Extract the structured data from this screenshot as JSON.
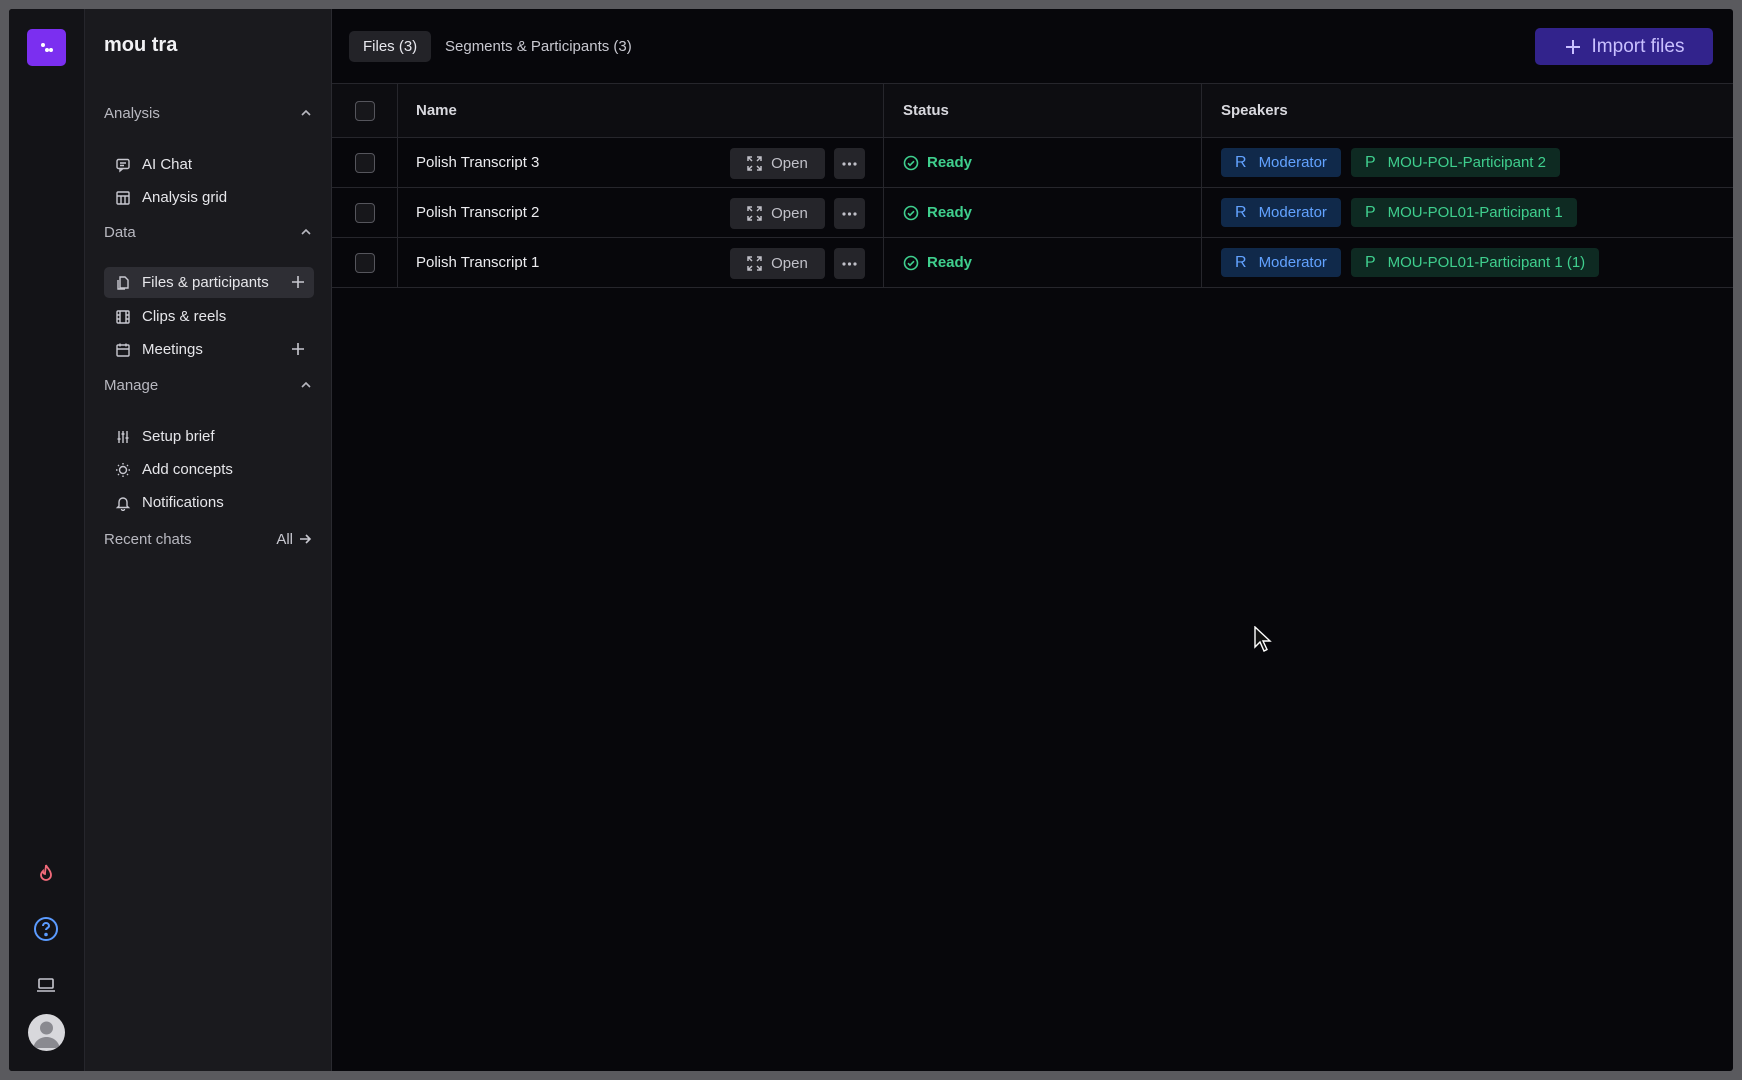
{
  "project": {
    "title": "mou tra"
  },
  "rail": {
    "icons": [
      "logo-icon",
      "flame-icon",
      "help-icon",
      "laptop-icon",
      "avatar"
    ]
  },
  "sidebar": {
    "analysis": {
      "label": "Analysis",
      "items": [
        {
          "label": "AI Chat",
          "icon": "chat-icon"
        },
        {
          "label": "Analysis grid",
          "icon": "grid-icon"
        }
      ]
    },
    "data": {
      "label": "Data",
      "items": [
        {
          "label": "Files & participants",
          "icon": "files-icon",
          "active": true
        },
        {
          "label": "Clips & reels",
          "icon": "film-icon"
        },
        {
          "label": "Meetings",
          "icon": "calendar-icon"
        }
      ]
    },
    "manage": {
      "label": "Manage",
      "items": [
        {
          "label": "Setup brief",
          "icon": "sliders-icon"
        },
        {
          "label": "Add concepts",
          "icon": "bulb-icon"
        },
        {
          "label": "Notifications",
          "icon": "bell-icon"
        }
      ]
    },
    "recent": {
      "label": "Recent chats",
      "all_label": "All"
    }
  },
  "tabs": [
    {
      "label": "Files (3)",
      "active": true
    },
    {
      "label": "Segments & Participants (3)",
      "active": false
    }
  ],
  "import_label": "Import files",
  "table": {
    "columns": [
      "Name",
      "Status",
      "Speakers"
    ],
    "open_label": "Open",
    "rows": [
      {
        "name": "Polish Transcript 3",
        "status": "Ready",
        "moderator": {
          "initial": "R",
          "label": "Moderator"
        },
        "participant": {
          "initial": "P",
          "label": "MOU-POL-Participant 2"
        }
      },
      {
        "name": "Polish Transcript 2",
        "status": "Ready",
        "moderator": {
          "initial": "R",
          "label": "Moderator"
        },
        "participant": {
          "initial": "P",
          "label": "MOU-POL01-Participant 1"
        }
      },
      {
        "name": "Polish Transcript 1",
        "status": "Ready",
        "moderator": {
          "initial": "R",
          "label": "Moderator"
        },
        "participant": {
          "initial": "P",
          "label": "MOU-POL01-Participant 1 (1)"
        }
      }
    ]
  },
  "colors": {
    "accent": "#7b2ff0",
    "ready": "#3fcf8e",
    "moderator": "#62a2ff"
  }
}
